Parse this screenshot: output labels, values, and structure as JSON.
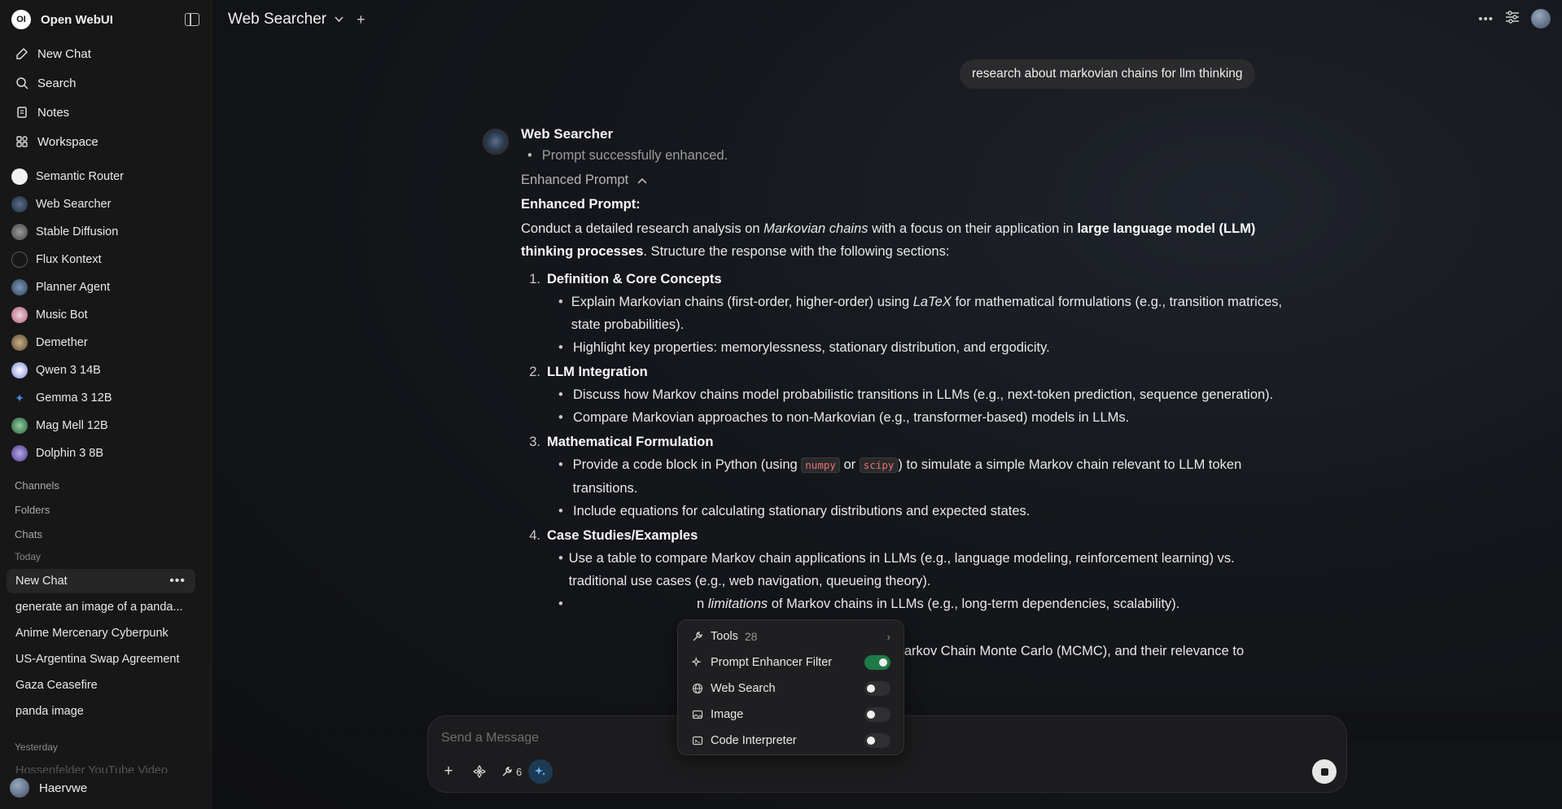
{
  "app": {
    "name": "Open WebUI",
    "logo_text": "OI"
  },
  "sidebar": {
    "nav": [
      {
        "label": "New Chat",
        "icon": "edit-icon"
      },
      {
        "label": "Search",
        "icon": "search-icon"
      },
      {
        "label": "Notes",
        "icon": "notes-icon"
      },
      {
        "label": "Workspace",
        "icon": "workspace-icon"
      }
    ],
    "models": [
      {
        "label": "Semantic Router",
        "color": "#f2f2f2"
      },
      {
        "label": "Web Searcher",
        "color": "#2e3f57"
      },
      {
        "label": "Stable Diffusion",
        "color": "#6e6e6e"
      },
      {
        "label": "Flux Kontext",
        "color": "#e6e6e6"
      },
      {
        "label": "Planner Agent",
        "color": "#4a6585"
      },
      {
        "label": "Music Bot",
        "color": "#c9a0b0"
      },
      {
        "label": "Demether",
        "color": "#8a7a5a"
      },
      {
        "label": "Qwen 3 14B",
        "color": "#dfe3ff"
      },
      {
        "label": "Gemma 3 12B",
        "color": "#4a86d8"
      },
      {
        "label": "Mag Mell 12B",
        "color": "#4f8a5a"
      },
      {
        "label": "Dolphin 3 8B",
        "color": "#7a6ab0"
      }
    ],
    "sections": {
      "channels": "Channels",
      "folders": "Folders",
      "chats": "Chats",
      "today": "Today",
      "yesterday": "Yesterday"
    },
    "chats_today": [
      "New Chat",
      "generate an image of a panda...",
      "Anime Mercenary Cyberpunk",
      "US-Argentina Swap Agreement",
      "Gaza Ceasefire",
      "panda image"
    ],
    "chats_yesterday": [
      "Hossenfelder YouTube Video"
    ],
    "user": {
      "name": "Haervwe"
    }
  },
  "topbar": {
    "title": "Web Searcher"
  },
  "conversation": {
    "user_message": "research about markovian chains for llm thinking",
    "assistant": {
      "name": "Web Searcher",
      "status": "Prompt successfully enhanced.",
      "toggle_label": "Enhanced Prompt",
      "heading": "Enhanced Prompt:",
      "intro_1": "Conduct a detailed research analysis on ",
      "intro_italic": "Markovian chains",
      "intro_2": " with a focus on their application in ",
      "intro_bold": "large language model (LLM) thinking processes",
      "intro_3": ". Structure the response with the following sections:",
      "sections": [
        {
          "num": "1.",
          "title": "Definition & Core Concepts"
        },
        {
          "num": "2.",
          "title": "LLM Integration"
        },
        {
          "num": "3.",
          "title": "Mathematical Formulation"
        },
        {
          "num": "4.",
          "title": "Case Studies/Examples"
        }
      ],
      "s1_b1_a": "Explain Markovian chains (first-order, higher-order) using ",
      "s1_b1_i": "LaTeX",
      "s1_b1_b": " for mathematical formulations (e.g., transition matrices, state probabilities).",
      "s1_b2": "Highlight key properties: memorylessness, stationary distribution, and ergodicity.",
      "s2_b1": "Discuss how Markov chains model probabilistic transitions in LLMs (e.g., next-token prediction, sequence generation).",
      "s2_b2": "Compare Markovian approaches to non-Markovian (e.g., transformer-based) models in LLMs.",
      "s3_b1_a": "Provide a code block in Python (using ",
      "s3_code1": "numpy",
      "s3_or": " or ",
      "s3_code2": "scipy",
      "s3_b1_b": ") to simulate a simple Markov chain relevant to LLM token transitions.",
      "s3_b2": "Include equations for calculating stationary distributions and expected states.",
      "s4_b1": "Use a table to compare Markov chain applications in LLMs (e.g., language modeling, reinforcement learning) vs. traditional use cases (e.g., web navigation, queueing theory).",
      "s4_b2_a": "n ",
      "s4_b2_i": "limitations",
      "s4_b2_b": " of Markov chains in LLMs (e.g., long-term dependencies, scalability).",
      "s5_b1": "Hidden Markov Models (HMMs), Markov Chain Monte Carlo (MCMC), and their relevance to"
    }
  },
  "input": {
    "placeholder": "Send a Message",
    "tool_count": "6"
  },
  "tools_menu": {
    "title": "Tools",
    "count": "28",
    "items": [
      {
        "label": "Prompt Enhancer Filter",
        "enabled": true
      },
      {
        "label": "Web Search",
        "enabled": false
      },
      {
        "label": "Image",
        "enabled": false
      },
      {
        "label": "Code Interpreter",
        "enabled": false
      }
    ]
  },
  "colors": {
    "accent": "#69b6ff",
    "toggle_on": "#1e7a46",
    "code": "#e57373"
  }
}
